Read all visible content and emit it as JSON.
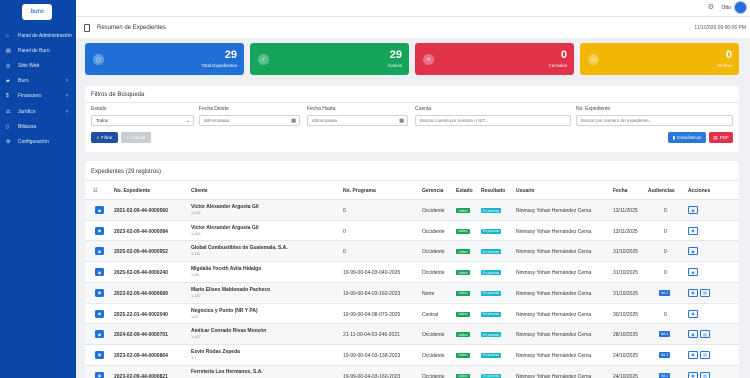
{
  "brand": {
    "logo_text": "buro"
  },
  "sidebar": {
    "items": [
      {
        "label": "Panel de Administración",
        "icon": "home-icon",
        "chevron": false
      },
      {
        "label": "Panel de Buro",
        "icon": "dashboard-icon",
        "chevron": false
      },
      {
        "label": "Sitio Web",
        "icon": "globe-icon",
        "chevron": false
      },
      {
        "label": "Buro",
        "icon": "folder-icon",
        "chevron": true
      },
      {
        "label": "Financiero",
        "icon": "money-icon",
        "chevron": true
      },
      {
        "label": "Jurídico",
        "icon": "scale-icon",
        "chevron": true
      },
      {
        "label": "Bitácora",
        "icon": "book-icon",
        "chevron": false
      },
      {
        "label": "Configuración",
        "icon": "gear-icon",
        "chevron": false
      }
    ]
  },
  "topbar": {
    "user": "Otto"
  },
  "header": {
    "title": "Resumen de Expedientes",
    "datetime": "11/1/2026 09:00:06 PM"
  },
  "cards": [
    {
      "value": "29",
      "label": "Total Expedientes",
      "color": "#1f6fd6",
      "icon": "folder-icon"
    },
    {
      "value": "29",
      "label": "Activos",
      "color": "#16a35a",
      "icon": "check-icon"
    },
    {
      "value": "0",
      "label": "Cerrados",
      "color": "#e0334a",
      "icon": "close-icon"
    },
    {
      "value": "0",
      "label": "Archivo",
      "color": "#f2b705",
      "icon": "archive-icon"
    }
  ],
  "filters": {
    "title": "Filtros de Búsqueda",
    "estado_label": "Estado",
    "estado_value": "Todos",
    "desde_label": "Fecha Desde",
    "desde_placeholder": "dd/mm/aaaa",
    "hasta_label": "Fecha Hasta",
    "hasta_placeholder": "dd/mm/aaaa",
    "cuenta_label": "Cuenta",
    "cuenta_placeholder": "Buscar cuenta por nombre o NIT...",
    "expediente_label": "No. Expediente",
    "expediente_placeholder": "Buscar por número de expediente...",
    "filtrar": "Filtrar",
    "limpiar": "Limpiar",
    "estadisticas": "Estadísticas",
    "pdf": "PDF"
  },
  "results": {
    "title": "Expedientes (29 registros)",
    "columns": [
      "No. Expediente",
      "Cliente",
      "No. Programa",
      "Gerencia",
      "Estado",
      "Resultado",
      "Usuario",
      "Fecha",
      "Audiencias",
      "Acciones"
    ],
    "rows": [
      {
        "exp": "2021-02-09-44-0000560",
        "client": "Victor Alexander Argueta Gil",
        "client_sub": "1-115",
        "programa": "0",
        "gerencia": "Occidente",
        "estado": "Activo",
        "resultado": "En proceso",
        "usuario": "Ninmssy Yohan Hernández Cerna",
        "fecha": "13/11/2025",
        "aud": "0",
        "aud_badge": ""
      },
      {
        "exp": "2023-02-09-44-0000084",
        "client": "Victor Alexander Argueta Gil",
        "client_sub": "1-116",
        "programa": "0",
        "gerencia": "Occidente",
        "estado": "Activo",
        "resultado": "En proceso",
        "usuario": "Ninmssy Yohan Hernández Cerna",
        "fecha": "13/11/2025",
        "aud": "0",
        "aud_badge": ""
      },
      {
        "exp": "2025-02-09-44-0000952",
        "client": "Global Combustibles de Guatemala, S.A.",
        "client_sub": "1-111",
        "programa": "0",
        "gerencia": "Occidente",
        "estado": "Activo",
        "resultado": "En proceso",
        "usuario": "Ninmssy Yohan Hernández Cerna",
        "fecha": "31/10/2025",
        "aud": "0",
        "aud_badge": ""
      },
      {
        "exp": "2025-02-09-44-0000240",
        "client": "Migdalia Yoceth Avila Hidalgo",
        "client_sub": "1-39",
        "programa": "19-99-00-04-03-040-2025",
        "gerencia": "Occidente",
        "estado": "Activo",
        "resultado": "En proceso",
        "usuario": "Ninmssy Yohan Hernández Cerna",
        "fecha": "31/10/2025",
        "aud": "0",
        "aud_badge": ""
      },
      {
        "exp": "2023-02-09-44-0000689",
        "client": "Mario Eliseo Maldonado Pacheco",
        "client_sub": "1-187",
        "programa": "19-99-00-04-03-160-2023",
        "gerencia": "Norte",
        "estado": "Activo",
        "resultado": "En proceso",
        "usuario": "Ninmssy Yohan Hernández Cerna",
        "fecha": "31/10/2025",
        "aud": "",
        "aud_badge": "VA 2"
      },
      {
        "exp": "2025-22-01-44-0002040",
        "client": "Negocios y Punto (NR Y PA)",
        "client_sub": "1-87",
        "programa": "19-99-00-04-08-073-2025",
        "gerencia": "Central",
        "estado": "Activo",
        "resultado": "En proceso",
        "usuario": "Ninmssy Yohan Hernández Cerna",
        "fecha": "30/10/2025",
        "aud": "0",
        "aud_badge": ""
      },
      {
        "exp": "2024-02-09-44-0000701",
        "client": "Amilcar Conrado Rivas Monzón",
        "client_sub": "1-167",
        "programa": "21-11-00-04-03-246-2021",
        "gerencia": "Occidente",
        "estado": "Activo",
        "resultado": "En proceso",
        "usuario": "Ninmssy Yohan Hernández Cerna",
        "fecha": "28/10/2025",
        "aud": "",
        "aud_badge": "VA 1"
      },
      {
        "exp": "2023-02-09-44-0000864",
        "client": "Esvin Rodas Zepeda",
        "client_sub": "1-7",
        "programa": "19-99-00-04-03-138-2023",
        "gerencia": "Occidente",
        "estado": "Activo",
        "resultado": "En proceso",
        "usuario": "Ninmssy Yohan Hernández Cerna",
        "fecha": "24/10/2025",
        "aud": "",
        "aud_badge": "VA 1"
      },
      {
        "exp": "2023-02-09-44-0000821",
        "client": "Ferretería Los Hermanos, S.A.",
        "client_sub": "",
        "programa": "19-99-00-04-03-160-2023",
        "gerencia": "Occidente",
        "estado": "Activo",
        "resultado": "En proceso",
        "usuario": "Ninmssy Yohan Hernández Cerna",
        "fecha": "24/10/2025",
        "aud": "",
        "aud_badge": "VA 1"
      }
    ]
  }
}
